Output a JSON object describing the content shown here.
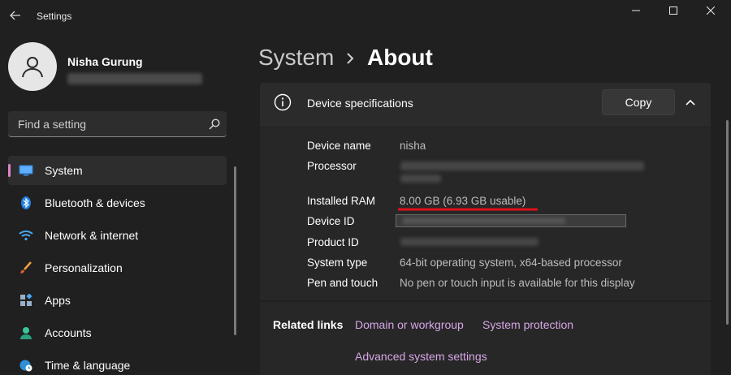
{
  "window": {
    "title": "Settings",
    "controls": {
      "minimize": "—",
      "maximize": "☐",
      "close": "✕"
    }
  },
  "profile": {
    "name": "Nisha Gurung"
  },
  "search": {
    "placeholder": "Find a setting"
  },
  "sidebar": {
    "items": [
      {
        "label": "System",
        "icon": "monitor-icon",
        "active": true
      },
      {
        "label": "Bluetooth & devices",
        "icon": "bluetooth-icon"
      },
      {
        "label": "Network & internet",
        "icon": "wifi-icon"
      },
      {
        "label": "Personalization",
        "icon": "brush-icon"
      },
      {
        "label": "Apps",
        "icon": "apps-icon"
      },
      {
        "label": "Accounts",
        "icon": "person-icon"
      },
      {
        "label": "Time & language",
        "icon": "globe-clock-icon"
      }
    ]
  },
  "header": {
    "crumb_parent": "System",
    "crumb_current": "About"
  },
  "device_specs": {
    "title": "Device specifications",
    "copy_label": "Copy",
    "rows": [
      {
        "label": "Device name",
        "value": "nisha"
      },
      {
        "label": "Processor",
        "value": ""
      },
      {
        "label": "Installed RAM",
        "value": "8.00 GB (6.93 GB usable)"
      },
      {
        "label": "Device ID",
        "value": ""
      },
      {
        "label": "Product ID",
        "value": ""
      },
      {
        "label": "System type",
        "value": "64-bit operating system, x64-based processor"
      },
      {
        "label": "Pen and touch",
        "value": "No pen or touch input is available for this display"
      }
    ]
  },
  "related": {
    "label": "Related links",
    "links": [
      "Domain or workgroup",
      "System protection",
      "Advanced system settings"
    ]
  },
  "colors": {
    "accent": "#dd84ca",
    "link": "#d7a6e6",
    "annotation": "#e0101a",
    "background": "#202020"
  }
}
